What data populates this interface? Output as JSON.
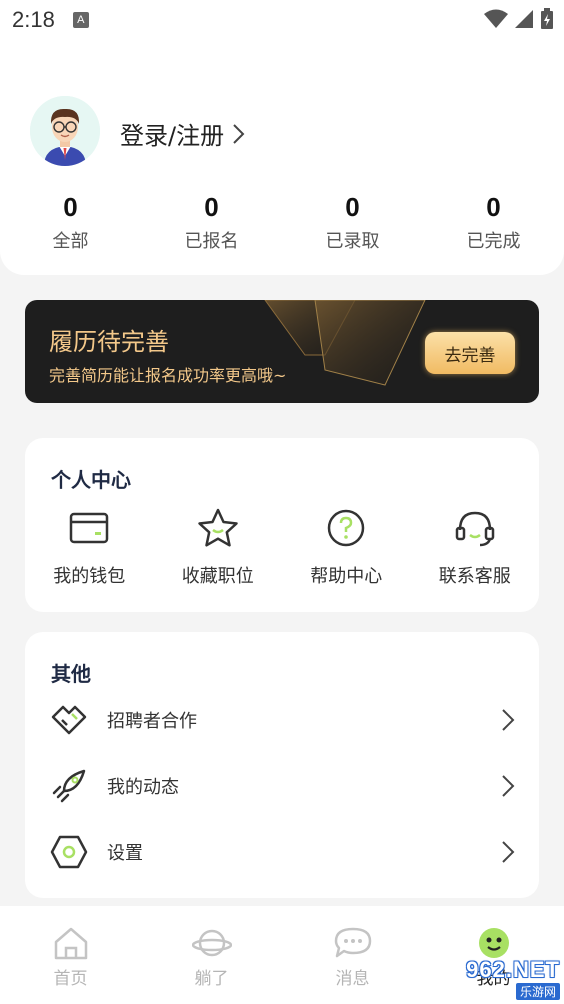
{
  "status_bar": {
    "time": "2:18",
    "notif_letter": "A"
  },
  "profile": {
    "login_text": "登录/注册"
  },
  "stats": [
    {
      "num": "0",
      "label": "全部"
    },
    {
      "num": "0",
      "label": "已报名"
    },
    {
      "num": "0",
      "label": "已录取"
    },
    {
      "num": "0",
      "label": "已完成"
    }
  ],
  "banner": {
    "title": "履历待完善",
    "subtitle": "完善简历能让报名成功率更高哦~",
    "button": "去完善"
  },
  "personal": {
    "title": "个人中心",
    "items": [
      {
        "label": "我的钱包",
        "icon": "wallet-icon"
      },
      {
        "label": "收藏职位",
        "icon": "star-icon"
      },
      {
        "label": "帮助中心",
        "icon": "help-icon"
      },
      {
        "label": "联系客服",
        "icon": "headset-icon"
      }
    ]
  },
  "other": {
    "title": "其他",
    "items": [
      {
        "label": "招聘者合作",
        "icon": "handshake-icon"
      },
      {
        "label": "我的动态",
        "icon": "rocket-icon"
      },
      {
        "label": "设置",
        "icon": "settings-icon"
      }
    ]
  },
  "tabs": [
    {
      "label": "首页",
      "icon": "home-icon"
    },
    {
      "label": "躺了",
      "icon": "planet-icon"
    },
    {
      "label": "消息",
      "icon": "chat-icon"
    },
    {
      "label": "我的",
      "icon": "smiley-icon"
    }
  ],
  "watermark": {
    "top": "962.NET",
    "bottom": "乐游网"
  },
  "colors": {
    "accent": "#a8e063",
    "banner_bg": "#1e1e1e",
    "banner_text": "#f3c88a"
  }
}
